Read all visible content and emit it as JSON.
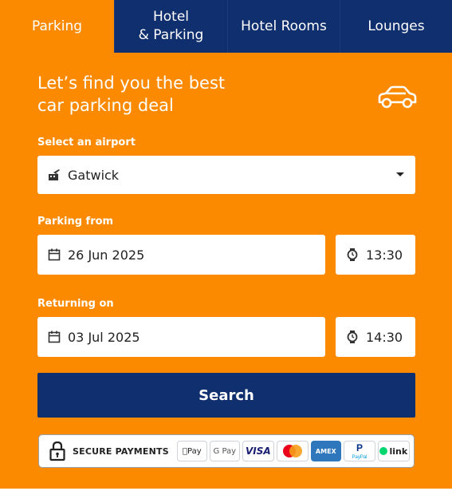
{
  "tabs": [
    {
      "label": "Parking",
      "active": true
    },
    {
      "label": "Hotel\n& Parking",
      "active": false
    },
    {
      "label": "Hotel Rooms",
      "active": false
    },
    {
      "label": "Lounges",
      "active": false
    }
  ],
  "headline": {
    "line1": "Let’s find you the best",
    "line2": "car parking deal",
    "icon": "car-icon"
  },
  "airport": {
    "label": "Select an airport",
    "value": "Gatwick",
    "icon": "plane-building-icon"
  },
  "parking_from": {
    "label": "Parking from",
    "date": "26 Jun 2025",
    "time": "13:30"
  },
  "returning_on": {
    "label": "Returning on",
    "date": "03 Jul 2025",
    "time": "14:30"
  },
  "search": {
    "label": "Search"
  },
  "secure": {
    "label": "SECURE PAYMENTS",
    "methods": {
      "apple": "Pay",
      "google": "G Pay",
      "visa": "VISA",
      "amex": "AMEX",
      "paypal": "PayPal",
      "link": "link"
    }
  },
  "colors": {
    "accent": "#fb8a00",
    "navy": "#102f6e",
    "white": "#ffffff"
  }
}
